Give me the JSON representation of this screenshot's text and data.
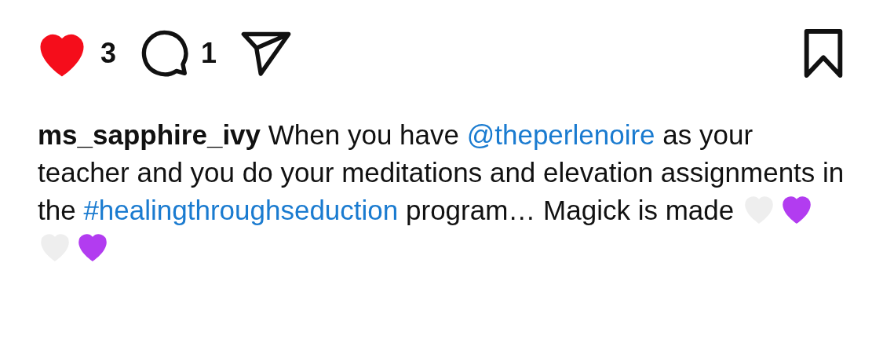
{
  "actions": {
    "liked": true,
    "like_count": "3",
    "comment_count": "1",
    "saved": false
  },
  "caption": {
    "username": "ms_sapphire_ivy",
    "parts": [
      {
        "kind": "text",
        "text": " When you have "
      },
      {
        "kind": "link",
        "text": "@theperlenoire"
      },
      {
        "kind": "text",
        "text": " as your teacher and you do your meditations and elevation assignments in the "
      },
      {
        "kind": "link",
        "text": "#healingthroughseduction"
      },
      {
        "kind": "text",
        "text": " program… Magick is made "
      }
    ],
    "emojis": [
      {
        "color": "#eeeeee"
      },
      {
        "color": "#b23cf0"
      },
      {
        "color": "#eeeeee"
      },
      {
        "color": "#b23cf0"
      }
    ]
  }
}
